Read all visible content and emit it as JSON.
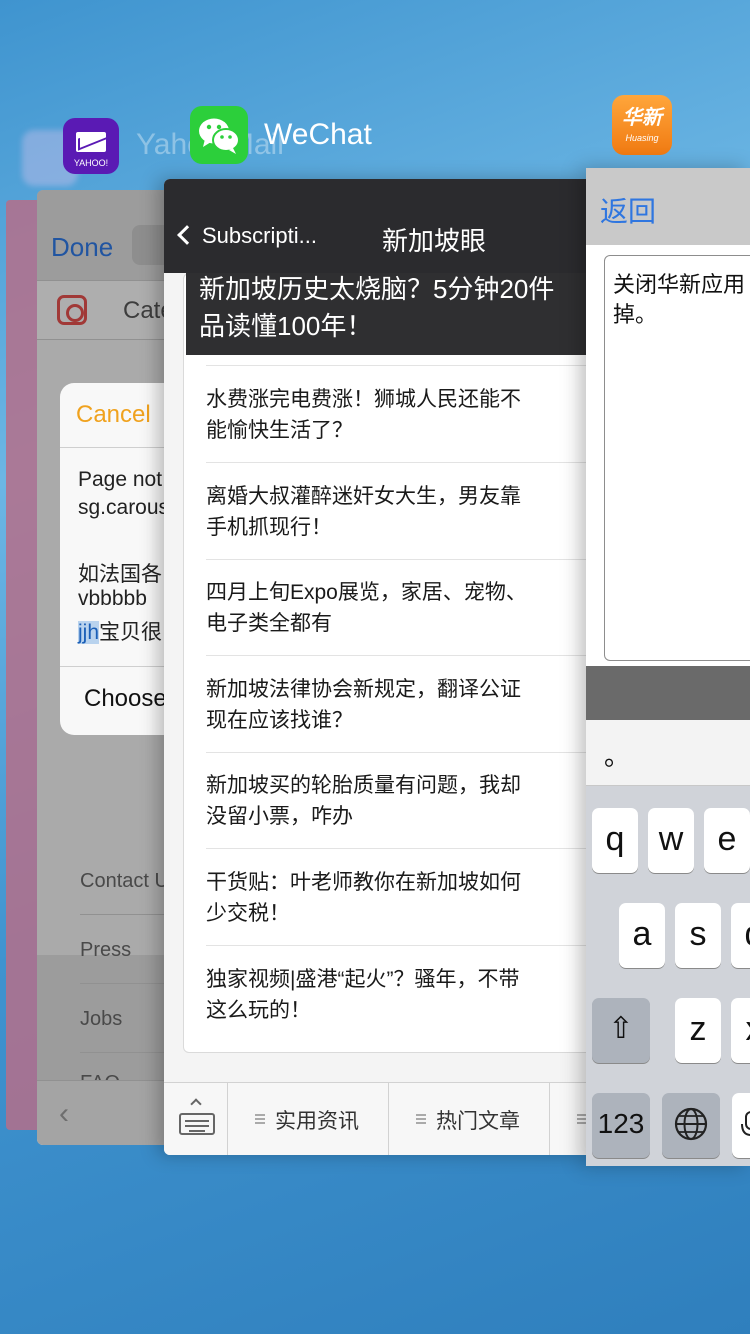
{
  "apps": {
    "yahoo": {
      "name": "Yahoo Mail",
      "icon_text": "YAHOO!",
      "done_label": "Done",
      "category_label": "Cate",
      "alert": {
        "cancel_label": "Cancel",
        "lines": [
          "Page not",
          "sg.carous"
        ],
        "body_line1": "如法国各",
        "body_line2": "vbbbbb",
        "body_line3_selected": "jjh",
        "body_line3_rest": "宝贝很",
        "choose_label": "Choose"
      },
      "footer_links": [
        "Contact U",
        "Press",
        "Jobs",
        "FAQ"
      ]
    },
    "wechat": {
      "name": "WeChat",
      "back_label": "Subscripti...",
      "title": "新加坡眼",
      "banner_lines": [
        "新加坡历史太烧脑？5分钟20件",
        "品读懂100年！"
      ],
      "articles": [
        [
          "水费涨完电费涨！狮城人民还能不",
          "能愉快生活了？"
        ],
        [
          "离婚大叔灌醉迷奸女大生，男友靠",
          "手机抓现行！"
        ],
        [
          "四月上旬Expo展览，家居、宠物、",
          "电子类全都有"
        ],
        [
          "新加坡法律协会新规定，翻译公证",
          "现在应该找谁？"
        ],
        [
          "新加坡买的轮胎质量有问题，我却",
          "没留小票，咋办"
        ],
        [
          "干货贴：叶老师教你在新加坡如何",
          "少交税！"
        ],
        [
          "独家视频|盛港“起火”？骚年，不带",
          "这么玩的！"
        ]
      ],
      "tabs": [
        "实用资讯",
        "热门文章"
      ]
    },
    "huaxin": {
      "icon_text": "华新",
      "icon_subtext": "Huasing",
      "back_label": "返回",
      "text_lines": [
        "关闭华新应用",
        "掉。"
      ],
      "candidate": "。",
      "keys_row1": [
        "q",
        "w",
        "e"
      ],
      "keys_row2": [
        "a",
        "s",
        "d"
      ],
      "keys_row3": [
        "z",
        "x"
      ],
      "key_numbers": "123"
    }
  },
  "colors": {
    "background": "#4a9fd6",
    "wechat_green": "#2ccf3b",
    "yahoo_purple": "#5a1ab4",
    "huaxin_orange": "#f58b1f",
    "ios_blue": "#2f76e0"
  }
}
